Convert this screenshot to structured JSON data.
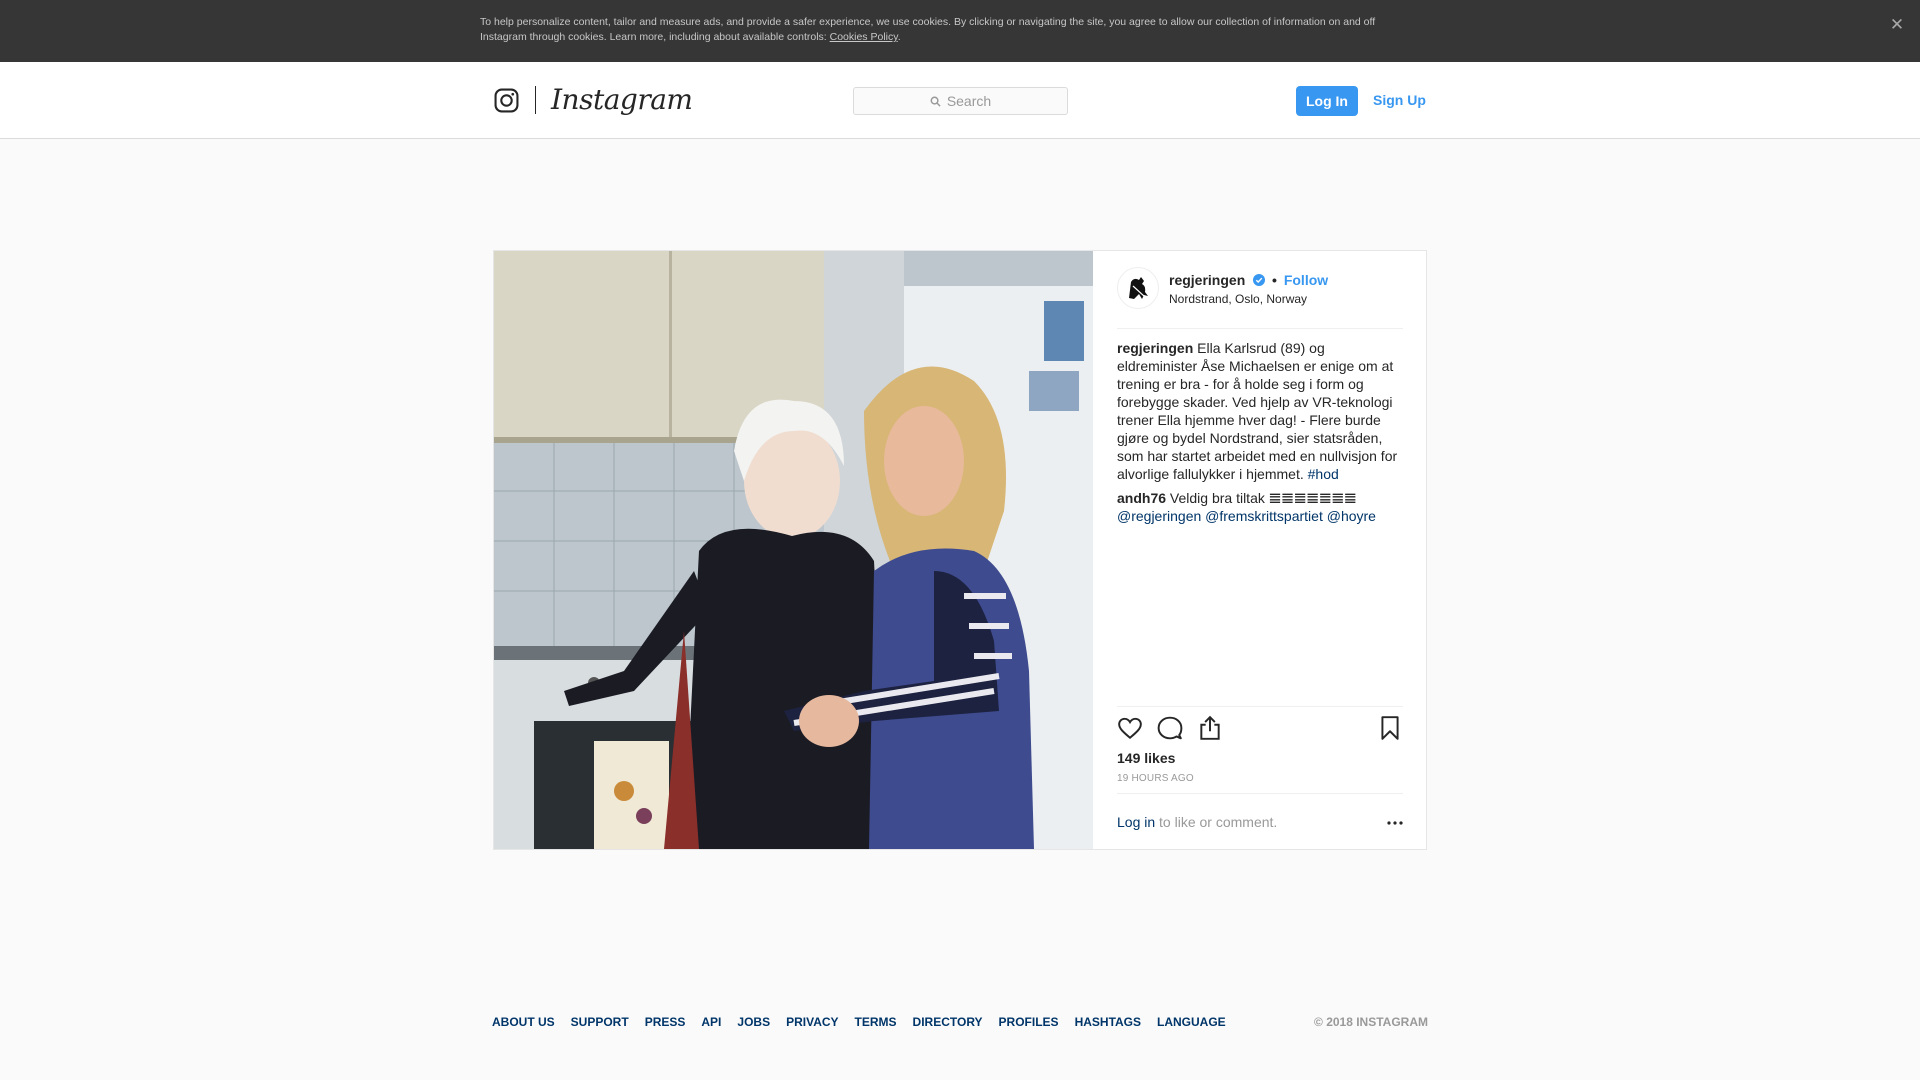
{
  "cookie_banner": {
    "text": "To help personalize content, tailor and measure ads, and provide a safer experience, we use cookies. By clicking or navigating the site, you agree to allow our collection of information on and off Instagram through cookies. Learn more, including about available controls:",
    "link": "Cookies Policy",
    "close_glyph": "✕"
  },
  "header": {
    "wordmark": "Instagram",
    "search_placeholder": "Search",
    "login_label": "Log In",
    "signup_label": "Sign Up"
  },
  "post": {
    "username": "regjeringen",
    "follow_label": "Follow",
    "separator": "•",
    "location": "Nordstrand, Oslo, Norway",
    "caption": {
      "user": "regjeringen",
      "text": "Ella Karlsrud (89) og eldreminister Åse Michaelsen er enige om at trening er bra - for å holde seg i form og forebygge skader. Ved hjelp av VR-teknologi trener Ella hjemme hver dag! - Flere burde gjøre og bydel Nordstrand, sier statsråden, som har startet arbeidet med en nullvisjon for alvorlige fallulykker i hjemmet.",
      "hashtag": "#hod"
    },
    "comment": {
      "user": "andh76",
      "text": "Veldig bra tiltak",
      "emoji": "𝌆𝌆𝌆𝌆𝌆𝌆𝌆",
      "mentions": [
        "@regjeringen",
        "@fremskrittspartiet",
        "@hoyre"
      ]
    },
    "likes": "149 likes",
    "timestamp": "19 HOURS AGO",
    "login_link": "Log in",
    "login_suffix": "to like or comment.",
    "more_glyph": "•••"
  },
  "footer": {
    "links": [
      "ABOUT US",
      "SUPPORT",
      "PRESS",
      "API",
      "JOBS",
      "PRIVACY",
      "TERMS",
      "DIRECTORY",
      "PROFILES",
      "HASHTAGS",
      "LANGUAGE"
    ],
    "copyright": "© 2018 INSTAGRAM"
  },
  "colors": {
    "accent": "#3897f0",
    "link": "#003569",
    "banner": "#363636"
  },
  "icons": [
    "camera-icon",
    "search-icon",
    "verified-icon",
    "heart-icon",
    "comment-icon",
    "share-icon",
    "bookmark-icon",
    "more-icon",
    "close-icon"
  ]
}
